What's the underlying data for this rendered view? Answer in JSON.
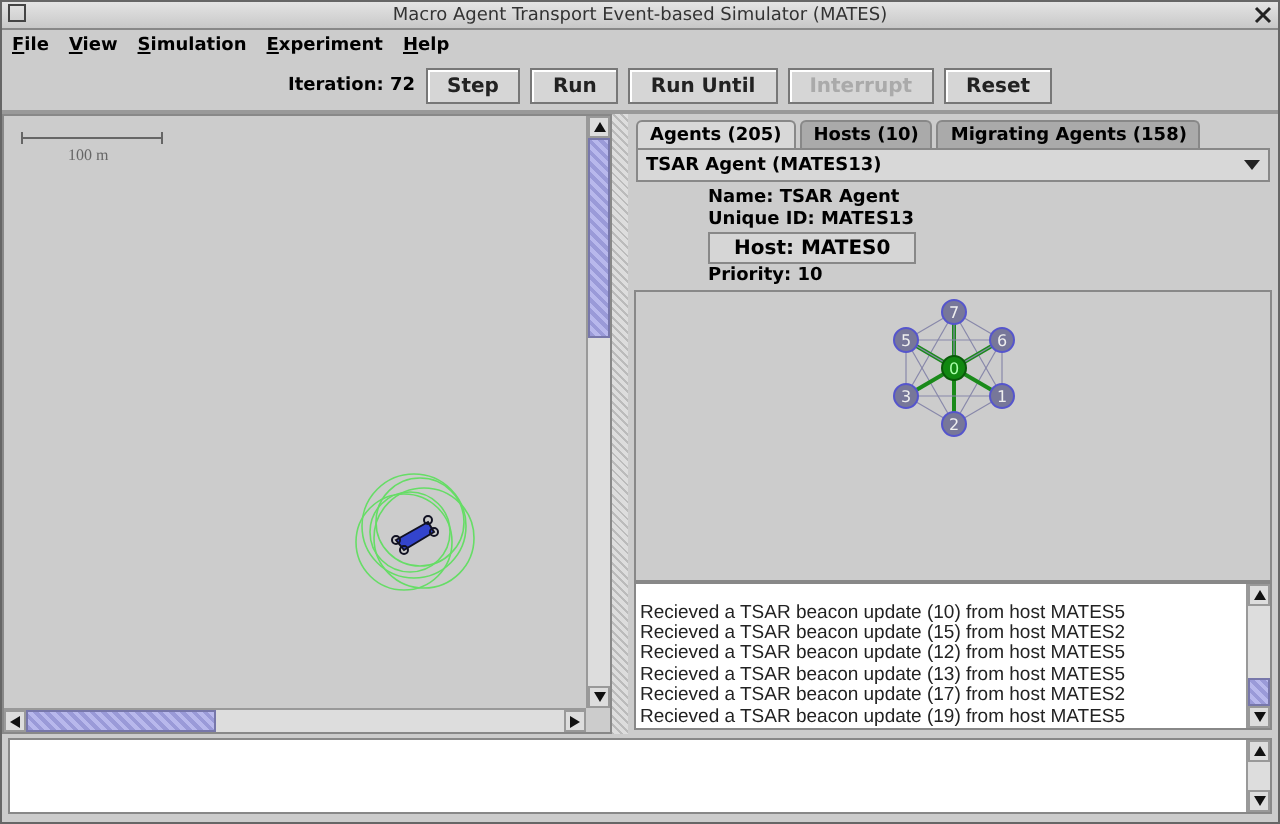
{
  "window": {
    "title": "Macro Agent Transport Event-based Simulator (MATES)"
  },
  "menu": [
    "File",
    "View",
    "Simulation",
    "Experiment",
    "Help"
  ],
  "toolbar": {
    "iteration_label": "Iteration: 72",
    "buttons": [
      {
        "label": "Step",
        "disabled": false
      },
      {
        "label": "Run",
        "disabled": false
      },
      {
        "label": "Run Until",
        "disabled": false
      },
      {
        "label": "Interrupt",
        "disabled": true
      },
      {
        "label": "Reset",
        "disabled": false
      }
    ]
  },
  "map": {
    "scale_label": "100 m"
  },
  "tabs": [
    {
      "label": "Agents (205)",
      "selected": true
    },
    {
      "label": "Hosts (10)",
      "selected": false
    },
    {
      "label": "Migrating Agents (158)",
      "selected": false
    }
  ],
  "agent_select": {
    "value": "TSAR Agent (MATES13)"
  },
  "agent": {
    "name": "Name: TSAR Agent",
    "unique_id": "Unique ID: MATES13",
    "host_button": "Host: MATES0",
    "priority": "Priority: 10"
  },
  "network": {
    "nodes": [
      {
        "label": "7",
        "center": false
      },
      {
        "label": "5",
        "center": false
      },
      {
        "label": "6",
        "center": false
      },
      {
        "label": "0",
        "center": true
      },
      {
        "label": "3",
        "center": false
      },
      {
        "label": "1",
        "center": false
      },
      {
        "label": "2",
        "center": false
      }
    ]
  },
  "log": [
    "Recieved a TSAR beacon update (10) from host MATES5",
    "Recieved a TSAR beacon update (15) from host MATES2",
    "Recieved a TSAR beacon update (12) from host MATES5",
    "Recieved a TSAR beacon update (13) from host MATES5",
    "Recieved a TSAR beacon update (17) from host MATES2",
    "Recieved a TSAR beacon update (19) from host MATES5"
  ]
}
